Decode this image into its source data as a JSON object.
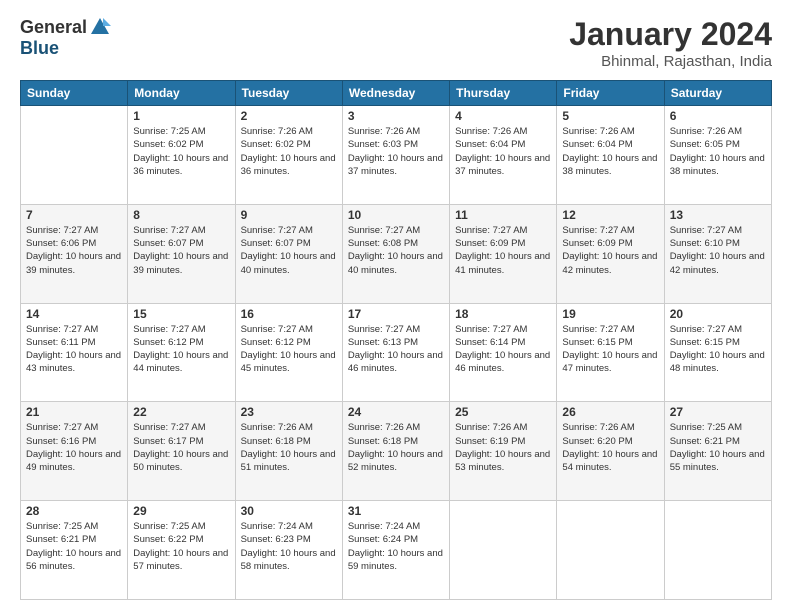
{
  "logo": {
    "general": "General",
    "blue": "Blue"
  },
  "title": "January 2024",
  "subtitle": "Bhinmal, Rajasthan, India",
  "columns": [
    "Sunday",
    "Monday",
    "Tuesday",
    "Wednesday",
    "Thursday",
    "Friday",
    "Saturday"
  ],
  "weeks": [
    [
      {
        "day": "",
        "sunrise": "",
        "sunset": "",
        "daylight": ""
      },
      {
        "day": "1",
        "sunrise": "Sunrise: 7:25 AM",
        "sunset": "Sunset: 6:02 PM",
        "daylight": "Daylight: 10 hours and 36 minutes."
      },
      {
        "day": "2",
        "sunrise": "Sunrise: 7:26 AM",
        "sunset": "Sunset: 6:02 PM",
        "daylight": "Daylight: 10 hours and 36 minutes."
      },
      {
        "day": "3",
        "sunrise": "Sunrise: 7:26 AM",
        "sunset": "Sunset: 6:03 PM",
        "daylight": "Daylight: 10 hours and 37 minutes."
      },
      {
        "day": "4",
        "sunrise": "Sunrise: 7:26 AM",
        "sunset": "Sunset: 6:04 PM",
        "daylight": "Daylight: 10 hours and 37 minutes."
      },
      {
        "day": "5",
        "sunrise": "Sunrise: 7:26 AM",
        "sunset": "Sunset: 6:04 PM",
        "daylight": "Daylight: 10 hours and 38 minutes."
      },
      {
        "day": "6",
        "sunrise": "Sunrise: 7:26 AM",
        "sunset": "Sunset: 6:05 PM",
        "daylight": "Daylight: 10 hours and 38 minutes."
      }
    ],
    [
      {
        "day": "7",
        "sunrise": "Sunrise: 7:27 AM",
        "sunset": "Sunset: 6:06 PM",
        "daylight": "Daylight: 10 hours and 39 minutes."
      },
      {
        "day": "8",
        "sunrise": "Sunrise: 7:27 AM",
        "sunset": "Sunset: 6:07 PM",
        "daylight": "Daylight: 10 hours and 39 minutes."
      },
      {
        "day": "9",
        "sunrise": "Sunrise: 7:27 AM",
        "sunset": "Sunset: 6:07 PM",
        "daylight": "Daylight: 10 hours and 40 minutes."
      },
      {
        "day": "10",
        "sunrise": "Sunrise: 7:27 AM",
        "sunset": "Sunset: 6:08 PM",
        "daylight": "Daylight: 10 hours and 40 minutes."
      },
      {
        "day": "11",
        "sunrise": "Sunrise: 7:27 AM",
        "sunset": "Sunset: 6:09 PM",
        "daylight": "Daylight: 10 hours and 41 minutes."
      },
      {
        "day": "12",
        "sunrise": "Sunrise: 7:27 AM",
        "sunset": "Sunset: 6:09 PM",
        "daylight": "Daylight: 10 hours and 42 minutes."
      },
      {
        "day": "13",
        "sunrise": "Sunrise: 7:27 AM",
        "sunset": "Sunset: 6:10 PM",
        "daylight": "Daylight: 10 hours and 42 minutes."
      }
    ],
    [
      {
        "day": "14",
        "sunrise": "Sunrise: 7:27 AM",
        "sunset": "Sunset: 6:11 PM",
        "daylight": "Daylight: 10 hours and 43 minutes."
      },
      {
        "day": "15",
        "sunrise": "Sunrise: 7:27 AM",
        "sunset": "Sunset: 6:12 PM",
        "daylight": "Daylight: 10 hours and 44 minutes."
      },
      {
        "day": "16",
        "sunrise": "Sunrise: 7:27 AM",
        "sunset": "Sunset: 6:12 PM",
        "daylight": "Daylight: 10 hours and 45 minutes."
      },
      {
        "day": "17",
        "sunrise": "Sunrise: 7:27 AM",
        "sunset": "Sunset: 6:13 PM",
        "daylight": "Daylight: 10 hours and 46 minutes."
      },
      {
        "day": "18",
        "sunrise": "Sunrise: 7:27 AM",
        "sunset": "Sunset: 6:14 PM",
        "daylight": "Daylight: 10 hours and 46 minutes."
      },
      {
        "day": "19",
        "sunrise": "Sunrise: 7:27 AM",
        "sunset": "Sunset: 6:15 PM",
        "daylight": "Daylight: 10 hours and 47 minutes."
      },
      {
        "day": "20",
        "sunrise": "Sunrise: 7:27 AM",
        "sunset": "Sunset: 6:15 PM",
        "daylight": "Daylight: 10 hours and 48 minutes."
      }
    ],
    [
      {
        "day": "21",
        "sunrise": "Sunrise: 7:27 AM",
        "sunset": "Sunset: 6:16 PM",
        "daylight": "Daylight: 10 hours and 49 minutes."
      },
      {
        "day": "22",
        "sunrise": "Sunrise: 7:27 AM",
        "sunset": "Sunset: 6:17 PM",
        "daylight": "Daylight: 10 hours and 50 minutes."
      },
      {
        "day": "23",
        "sunrise": "Sunrise: 7:26 AM",
        "sunset": "Sunset: 6:18 PM",
        "daylight": "Daylight: 10 hours and 51 minutes."
      },
      {
        "day": "24",
        "sunrise": "Sunrise: 7:26 AM",
        "sunset": "Sunset: 6:18 PM",
        "daylight": "Daylight: 10 hours and 52 minutes."
      },
      {
        "day": "25",
        "sunrise": "Sunrise: 7:26 AM",
        "sunset": "Sunset: 6:19 PM",
        "daylight": "Daylight: 10 hours and 53 minutes."
      },
      {
        "day": "26",
        "sunrise": "Sunrise: 7:26 AM",
        "sunset": "Sunset: 6:20 PM",
        "daylight": "Daylight: 10 hours and 54 minutes."
      },
      {
        "day": "27",
        "sunrise": "Sunrise: 7:25 AM",
        "sunset": "Sunset: 6:21 PM",
        "daylight": "Daylight: 10 hours and 55 minutes."
      }
    ],
    [
      {
        "day": "28",
        "sunrise": "Sunrise: 7:25 AM",
        "sunset": "Sunset: 6:21 PM",
        "daylight": "Daylight: 10 hours and 56 minutes."
      },
      {
        "day": "29",
        "sunrise": "Sunrise: 7:25 AM",
        "sunset": "Sunset: 6:22 PM",
        "daylight": "Daylight: 10 hours and 57 minutes."
      },
      {
        "day": "30",
        "sunrise": "Sunrise: 7:24 AM",
        "sunset": "Sunset: 6:23 PM",
        "daylight": "Daylight: 10 hours and 58 minutes."
      },
      {
        "day": "31",
        "sunrise": "Sunrise: 7:24 AM",
        "sunset": "Sunset: 6:24 PM",
        "daylight": "Daylight: 10 hours and 59 minutes."
      },
      {
        "day": "",
        "sunrise": "",
        "sunset": "",
        "daylight": ""
      },
      {
        "day": "",
        "sunrise": "",
        "sunset": "",
        "daylight": ""
      },
      {
        "day": "",
        "sunrise": "",
        "sunset": "",
        "daylight": ""
      }
    ]
  ]
}
